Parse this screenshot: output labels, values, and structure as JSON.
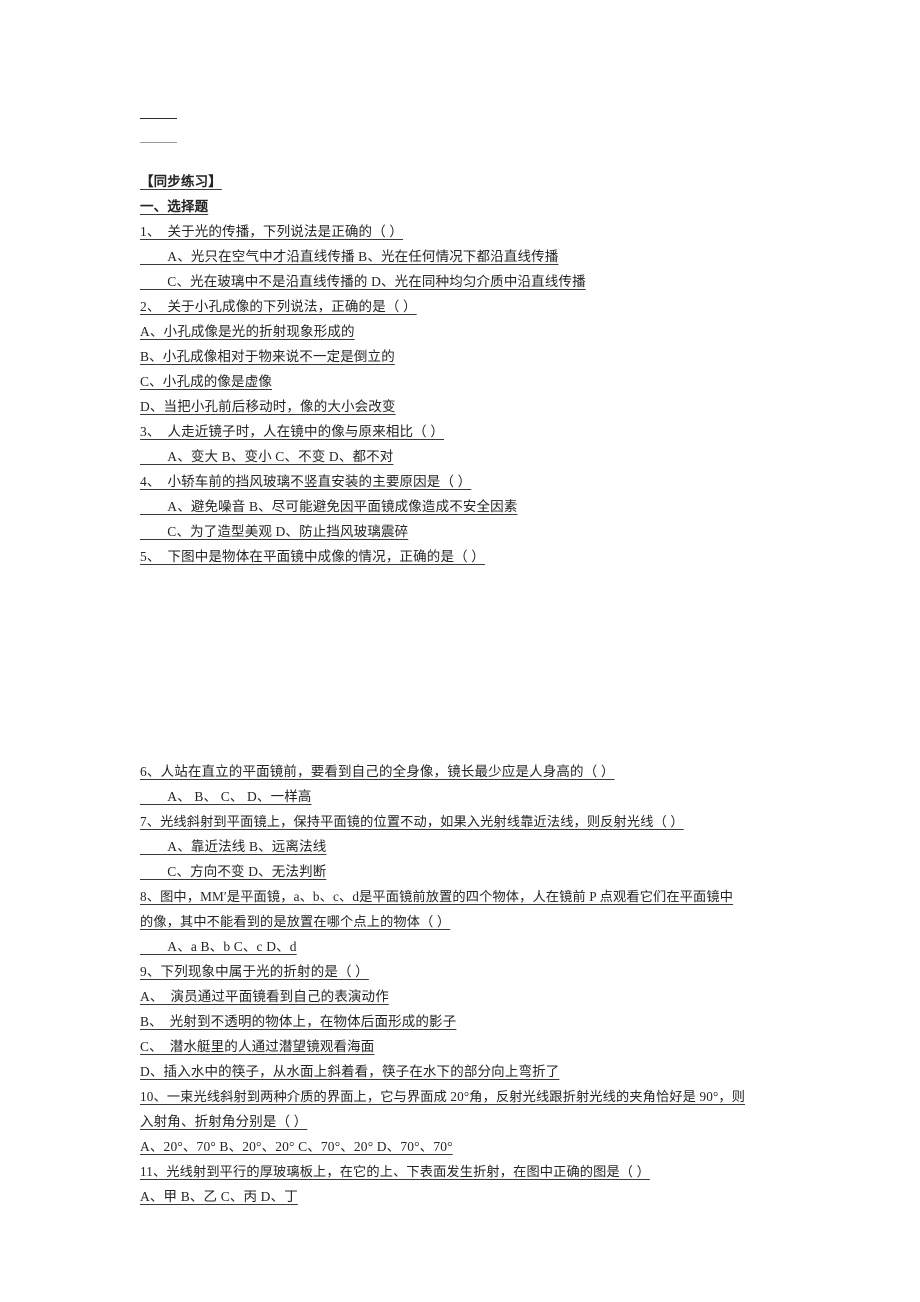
{
  "document": {
    "top_rules": [
      {
        "name": "blank-rule-1",
        "style": "dark"
      },
      {
        "name": "blank-rule-2",
        "style": "light"
      }
    ],
    "heading": "【同步练习】",
    "section_title": "一、选择题",
    "questions": [
      {
        "number": "1",
        "stem": "1、　关于光的传播，下列说法是正确的（ ）",
        "options": [
          "　　A、光只在空气中才沿直线传播 B、光在任何情况下都沿直线传播",
          "　　C、光在玻璃中不是沿直线传播的 D、光在同种均匀介质中沿直线传播"
        ]
      },
      {
        "number": "2",
        "stem": "2、　关于小孔成像的下列说法，正确的是（ ）",
        "options": [
          "A、小孔成像是光的折射现象形成的",
          "B、小孔成像相对于物来说不一定是倒立的",
          "C、小孔成的像是虚像",
          "D、当把小孔前后移动时，像的大小会改变"
        ]
      },
      {
        "number": "3",
        "stem": "3、　人走近镜子时，人在镜中的像与原来相比（ ）",
        "options": [
          "　　A、变大 B、变小 C、不变 D、都不对"
        ]
      },
      {
        "number": "4",
        "stem": "4、　小轿车前的挡风玻璃不竖直安装的主要原因是（ ）",
        "options": [
          "　　A、避免噪音 B、尽可能避免因平面镜成像造成不安全因素",
          "　　C、为了造型美观 D、防止挡风玻璃震碎"
        ]
      },
      {
        "number": "5",
        "stem": "5、　下图中是物体在平面镜中成像的情况，正确的是（ ）",
        "options": [],
        "figure_gap": true
      },
      {
        "number": "6",
        "stem": "6、人站在直立的平面镜前，要看到自己的全身像，镜长最少应是人身高的（ ）",
        "options": [
          "　　A、 B、 C、 D、一样高"
        ]
      },
      {
        "number": "7",
        "stem": "7、光线斜射到平面镜上，保持平面镜的位置不动，如果入光射线靠近法线，则反射光线（ ）",
        "options": [
          "　　A、靠近法线 B、远离法线",
          "　　C、方向不变 D、无法判断"
        ]
      },
      {
        "number": "8",
        "stem": "8、图中，MM′是平面镜，a、b、c、d是平面镜前放置的四个物体，人在镜前 P 点观看它们在平面镜中",
        "stem_cont": "的像，其中不能看到的是放置在哪个点上的物体（ ）",
        "options": [
          "　　A、a B、b C、c D、d"
        ]
      },
      {
        "number": "9",
        "stem": "9、下列现象中属于光的折射的是（ ）",
        "options": [
          "A、　演员通过平面镜看到自己的表演动作",
          "B、　光射到不透明的物体上，在物体后面形成的影子",
          "C、　潜水艇里的人通过潜望镜观看海面",
          "D、插入水中的筷子，从水面上斜着看，筷子在水下的部分向上弯折了"
        ]
      },
      {
        "number": "10",
        "stem": "10、一束光线斜射到两种介质的界面上，它与界面成 20°角，反射光线跟折射光线的夹角恰好是 90°，则",
        "stem_cont": "入射角、折射角分别是（ ）",
        "options": [
          "A、20°、70° B、20°、20° C、70°、20° D、70°、70°"
        ]
      },
      {
        "number": "11",
        "stem": "11、光线射到平行的厚玻璃板上，在它的上、下表面发生折射，在图中正确的图是（ ）",
        "options": [
          "A、甲 B、乙 C、丙 D、丁"
        ]
      }
    ]
  }
}
